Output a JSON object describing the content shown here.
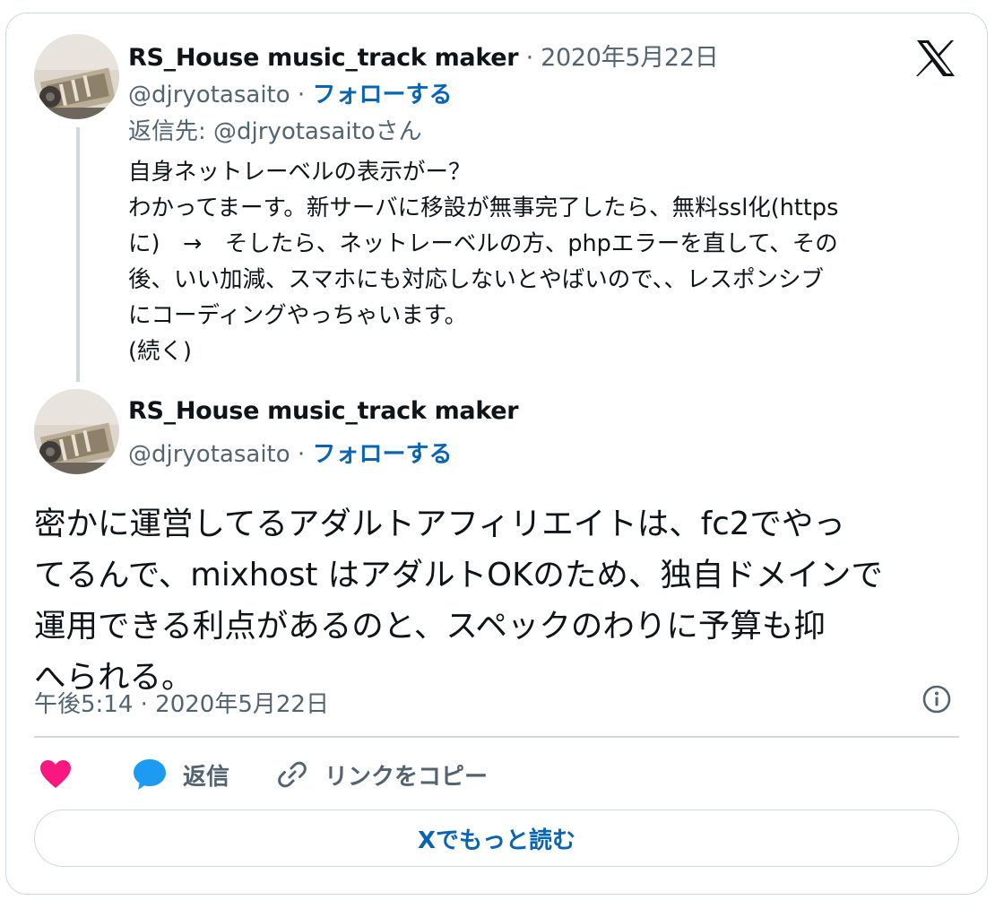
{
  "first_tweet": {
    "author_name": "RS_House music_track maker",
    "date_suffix": " · 2020年5月22日",
    "handle": "@djryotasaito",
    "separator": " · ",
    "follow_label": "フォローする",
    "reply_to": "返信先: @djryotasaitoさん",
    "lines": [
      "自身ネットレーベルの表示がー？",
      "わかってまーす。新サーバに移設が無事完了したら、無料ssl化(https",
      "に)　→　そしたら、ネットレーベルの方、phpエラーを直して、その",
      "後、いい加減、スマホにも対応しないとやばいので、、レスポンシブ",
      "にコーディングやっちゃいます。",
      "(続く)"
    ]
  },
  "main_tweet": {
    "author_name": "RS_House music_track maker",
    "handle": "@djryotasaito",
    "separator": " · ",
    "follow_label": "フォローする",
    "lines": [
      "密かに運営してるアダルトアフィリエイトは、fc2でやっ",
      "てるんで、mixhost はアダルトOKのため、独自ドメインで",
      "運用できる利点があるのと、スペックのわりに予算も抑",
      "へられる。"
    ],
    "timestamp": "午後5:14 · 2020年5月22日"
  },
  "actions": {
    "like_icon": "heart-icon",
    "reply_label": "返信",
    "copy_link_label": "リンクをコピー"
  },
  "read_more_label": "Xでもっと読む",
  "colors": {
    "link_blue": "#0a64b4",
    "heart_pink": "#f91880",
    "reply_blue": "#1d9bf0",
    "border": "#cfd9de",
    "gray_text": "#536471"
  }
}
